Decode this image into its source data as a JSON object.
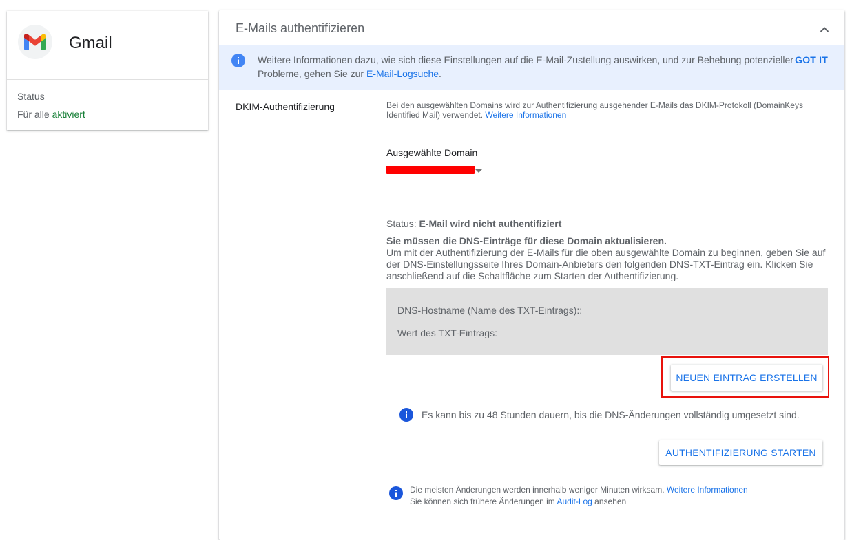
{
  "app": {
    "name": "Gmail",
    "status_label": "Status",
    "status_prefix": "Für alle",
    "status_value": "aktiviert"
  },
  "panel": {
    "title": "E-Mails authentifizieren",
    "banner": {
      "text_before": "Weitere Informationen dazu, wie sich diese Einstellungen auf die E-Mail-Zustellung auswirken, und zur Behebung potenzieller Probleme, gehen Sie zur ",
      "link": "E-Mail-Logsuche",
      "text_after": ".",
      "gotit": "GOT IT"
    },
    "section_label": "DKIM-Authentifizierung",
    "description": "Bei den ausgewählten Domains wird zur Authentifizierung ausgehender E-Mails das DKIM-Protokoll (DomainKeys Identified Mail) verwendet. ",
    "description_link": "Weitere Informationen",
    "domain_label": "Ausgewählte Domain",
    "status_prefix": "Status:",
    "status_value": "E-Mail wird nicht authentifiziert",
    "dns_heading": "Sie müssen die DNS-Einträge für diese Domain aktualisieren.",
    "dns_instructions": "Um mit der Authentifizierung der E-Mails für die oben ausgewählte Domain zu beginnen, geben Sie auf der DNS-Einstellungsseite Ihres Domain-Anbieters den folgenden DNS-TXT-Eintrag ein. Klicken Sie anschließend auf die Schaltfläche zum Starten der Authentifizierung.",
    "dns_hostname_label": "DNS-Hostname (Name des TXT-Eintrags)::",
    "dns_value_label": "Wert des TXT-Eintrags:",
    "btn_new_entry": "NEUEN EINTRAG ERSTELLEN",
    "note_propagation": "Es kann bis zu 48 Stunden dauern, bis die DNS-Änderungen vollständig umgesetzt sind.",
    "btn_start_auth": "AUTHENTIFIZIERUNG STARTEN",
    "footer_line1": "Die meisten Änderungen werden innerhalb weniger Minuten wirksam. ",
    "footer_link1": "Weitere Informationen",
    "footer_line2_before": "Sie können sich frühere Änderungen im ",
    "footer_link2": "Audit-Log",
    "footer_line2_after": " ansehen"
  },
  "colors": {
    "accent": "#1a73e8",
    "enabled": "#188038",
    "banner_bg": "#e8f0fe",
    "highlight": "#e8120c",
    "redaction": "#ff0000"
  }
}
